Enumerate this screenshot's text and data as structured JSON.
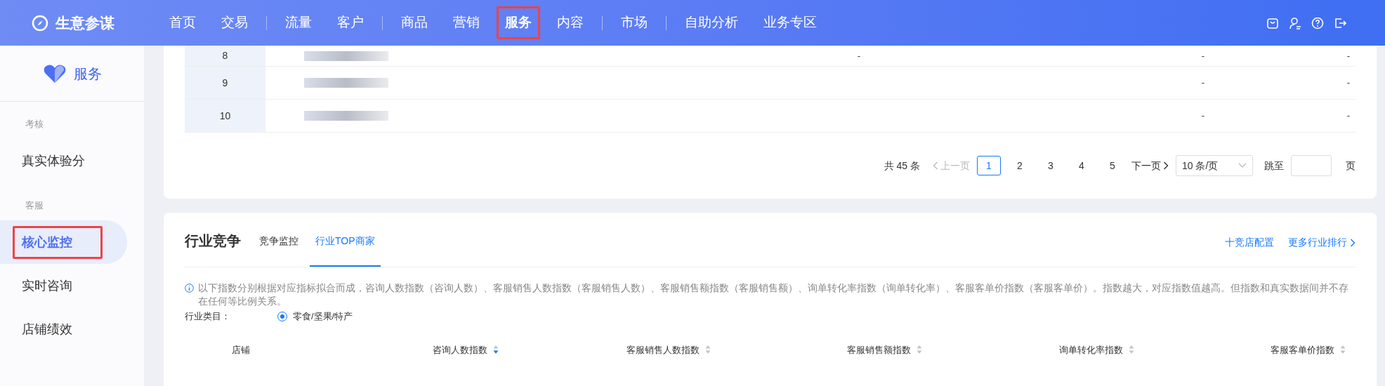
{
  "header": {
    "logo_text": "生意参谋",
    "nav_groups": [
      [
        {
          "label": "首页",
          "selected": false
        },
        {
          "label": "交易",
          "selected": false
        }
      ],
      [
        {
          "label": "流量",
          "selected": false
        },
        {
          "label": "客户",
          "selected": false
        }
      ],
      [
        {
          "label": "商品",
          "selected": false
        },
        {
          "label": "营销",
          "selected": false
        },
        {
          "label": "服务",
          "selected": true
        },
        {
          "label": "内容",
          "selected": false
        }
      ],
      [
        {
          "label": "市场",
          "selected": false
        }
      ],
      [
        {
          "label": "自助分析",
          "selected": false
        },
        {
          "label": "业务专区",
          "selected": false
        }
      ]
    ]
  },
  "sidebar": {
    "title": "服务",
    "groups": [
      {
        "heading": "考核",
        "items": [
          {
            "label": "真实体验分",
            "selected": false
          }
        ]
      },
      {
        "heading": "客服",
        "items": [
          {
            "label": "核心监控",
            "selected": true
          },
          {
            "label": "实时咨询",
            "selected": false
          },
          {
            "label": "店铺绩效",
            "selected": false
          }
        ]
      }
    ]
  },
  "top_table": {
    "rows": [
      {
        "index": "8",
        "column_3": "-",
        "column_4": "-",
        "column_5": "-"
      },
      {
        "index": "9",
        "column_4": "-",
        "column_5": "-"
      },
      {
        "index": "10",
        "column_4": "-",
        "column_5": "-"
      }
    ],
    "pagination": {
      "total": "共 45 条",
      "prev": "上一页",
      "pages": [
        {
          "label": "1",
          "selected": true
        },
        {
          "label": "2",
          "selected": false
        },
        {
          "label": "3",
          "selected": false
        },
        {
          "label": "4",
          "selected": false
        },
        {
          "label": "5",
          "selected": false
        }
      ],
      "next": "下一页",
      "page_size": "10 条/页",
      "jump_label": "跳至",
      "jump_suffix": "页"
    }
  },
  "competition": {
    "title": "行业竞争",
    "tabs": [
      {
        "label": "竞争监控",
        "selected": false
      },
      {
        "label": "行业TOP商家",
        "selected": true
      }
    ],
    "actions": [
      "十竞店配置",
      "更多行业排行"
    ],
    "notice": "以下指数分别根据对应指标拟合而成，咨询人数指数（咨询人数）、客服销售人数指数（客服销售人数）、客服销售额指数（客服销售额）、询单转化率指数（询单转化率）、客服客单价指数（客服客单价）。指数越大，对应指数值越高。但指数和真实数据间并不存在任何等比例关系。",
    "category_label": "行业类目：",
    "category": {
      "label": "零食/坚果/特产",
      "selected": true
    },
    "columns": [
      {
        "label": "店铺",
        "kind": "plain"
      },
      {
        "label": "咨询人数指数",
        "kind": "sortable",
        "sorted": true
      },
      {
        "label": "客服销售人数指数",
        "kind": "sortable",
        "sorted": false
      },
      {
        "label": "客服销售额指数",
        "kind": "sortable",
        "sorted": false
      },
      {
        "label": "询单转化率指数",
        "kind": "sortable",
        "sorted": false
      },
      {
        "label": "客服客单价指数",
        "kind": "sortable",
        "sorted": false
      }
    ]
  }
}
